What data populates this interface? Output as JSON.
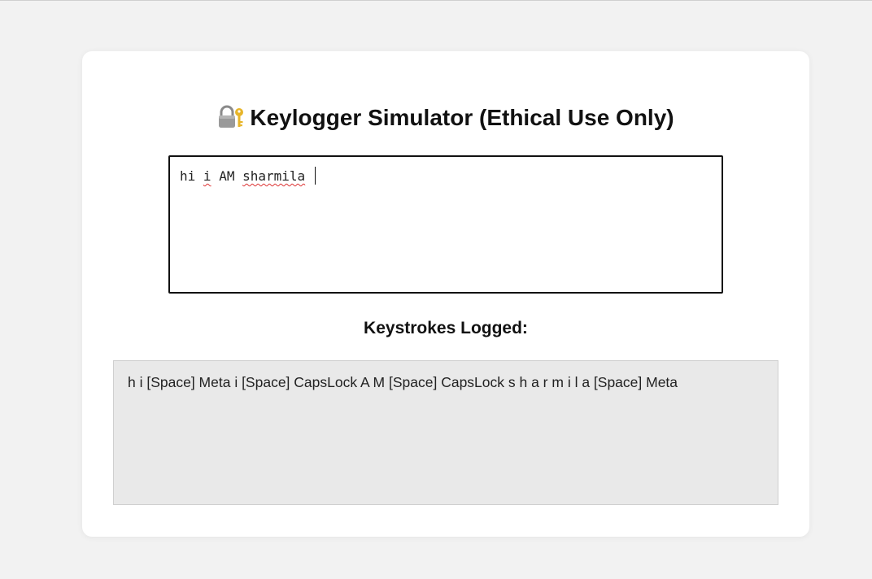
{
  "page": {
    "title": "Keylogger Simulator (Ethical Use Only)",
    "title_icon": "lock-with-key-icon"
  },
  "input": {
    "words": [
      "hi",
      "i",
      "AM",
      "sharmila"
    ],
    "misspelled": [
      false,
      true,
      false,
      true
    ]
  },
  "log": {
    "heading": "Keystrokes Logged:",
    "content": "h i [Space] Meta i [Space] CapsLock A M [Space] CapsLock s h a r m i l a [Space] Meta"
  },
  "colors": {
    "page_background": "#f2f2f2",
    "card_background": "#ffffff",
    "log_background": "#e9e9e9",
    "spellcheck_underline": "#d33333"
  }
}
